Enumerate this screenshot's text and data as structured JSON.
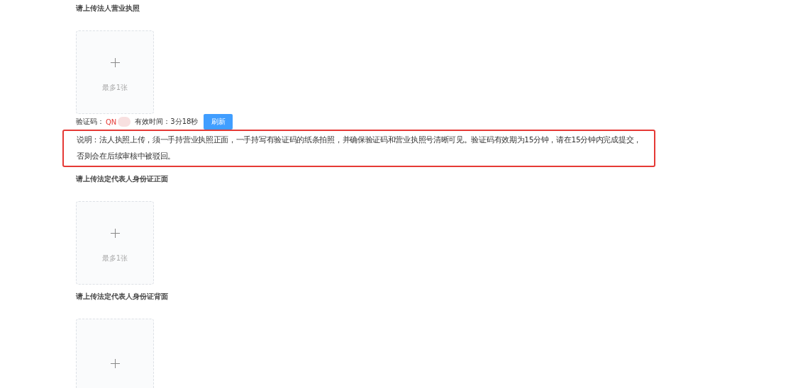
{
  "sections": [
    {
      "title": "请上传法人营业执照",
      "uploader": {
        "hint": "最多1张"
      },
      "verification": {
        "label": "验证码：",
        "code": "QN",
        "code_obscured": true,
        "validity_label": "有效时间：",
        "validity_value": "3分18秒",
        "refresh_button": "刷新"
      },
      "note": "说明：法人执照上传，须一手持营业执照正面，一手持写有验证码的纸条拍照，并确保验证码和营业执照号清晰可见。验证码有效期为15分钟，请在15分钟内完成提交，否则会在后续审核中被驳回。"
    },
    {
      "title": "请上传法定代表人身份证正面",
      "uploader": {
        "hint": "最多1张"
      }
    },
    {
      "title": "请上传法定代表人身份证背面"
    }
  ]
}
